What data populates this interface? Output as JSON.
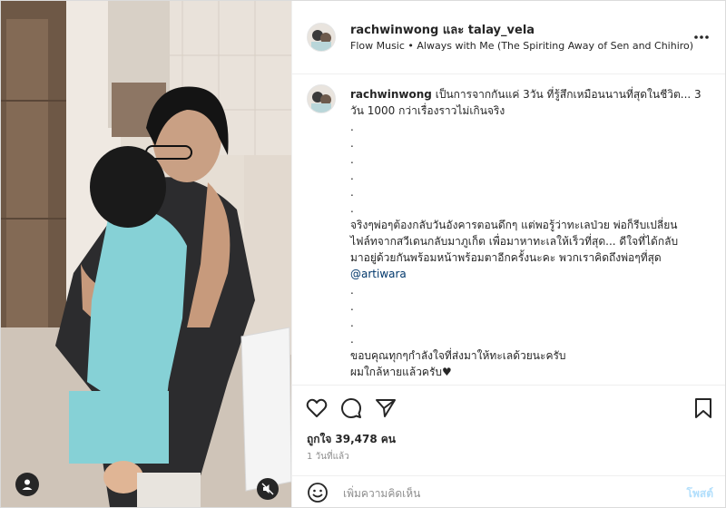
{
  "post": {
    "owners": "rachwinwong และ talay_vela",
    "music": "Flow Music • Always with Me (The Spiriting Away of Sen and Chihiro) [..."
  },
  "caption": {
    "username": "rachwinwong",
    "line1": "เป็นการจากกันแค่ 3วัน ที่รู้สึกเหมือนนานที่สุดในชีวิต... 3",
    "line2": "วัน 1000 กว่าเรื่องราวไม่เกินจริง",
    "dot": ".",
    "para2_line1": "จริงๆพ่อๆต้องกลับวันอังคารตอนดึกๆ แต่พอรู้ว่าทะเลป่วย พ่อก็รีบเปลี่ยน",
    "para2_line2": "ไฟล์ทจากสวีเดนกลับมาภูเก็ต เพื่อมาหาทะเลให้เร็วที่สุด... ดีใจที่ได้กลับ",
    "para2_line3": "มาอยู่ด้วยกันพร้อมหน้าพร้อมตาอีกครั้งนะคะ พวกเราคิดถึงพ่อๆที่สุด",
    "mention": "@artiwara",
    "para3_line1": "ขอบคุณทุกๆกำลังใจที่ส่งมาให้ทะเลด้วยนะครับ",
    "para3_line2": "ผมใกล้หายแล้วครับ♥"
  },
  "engagement": {
    "likes_label": "ถูกใจ",
    "likes_count": "39,478",
    "likes_unit": "คน",
    "time_ago": "1 วันที่แล้ว"
  },
  "comment_box": {
    "placeholder": "เพิ่มความคิดเห็น",
    "post_label": "โพสต์"
  },
  "icons": [
    "like-icon",
    "comment-icon",
    "share-icon",
    "save-icon",
    "more-icon",
    "emoji-icon",
    "user-tag-icon",
    "mute-icon"
  ],
  "colors": {
    "link": "#00376b",
    "post_button": "#b2dffc",
    "meta": "#8e8e8e"
  }
}
